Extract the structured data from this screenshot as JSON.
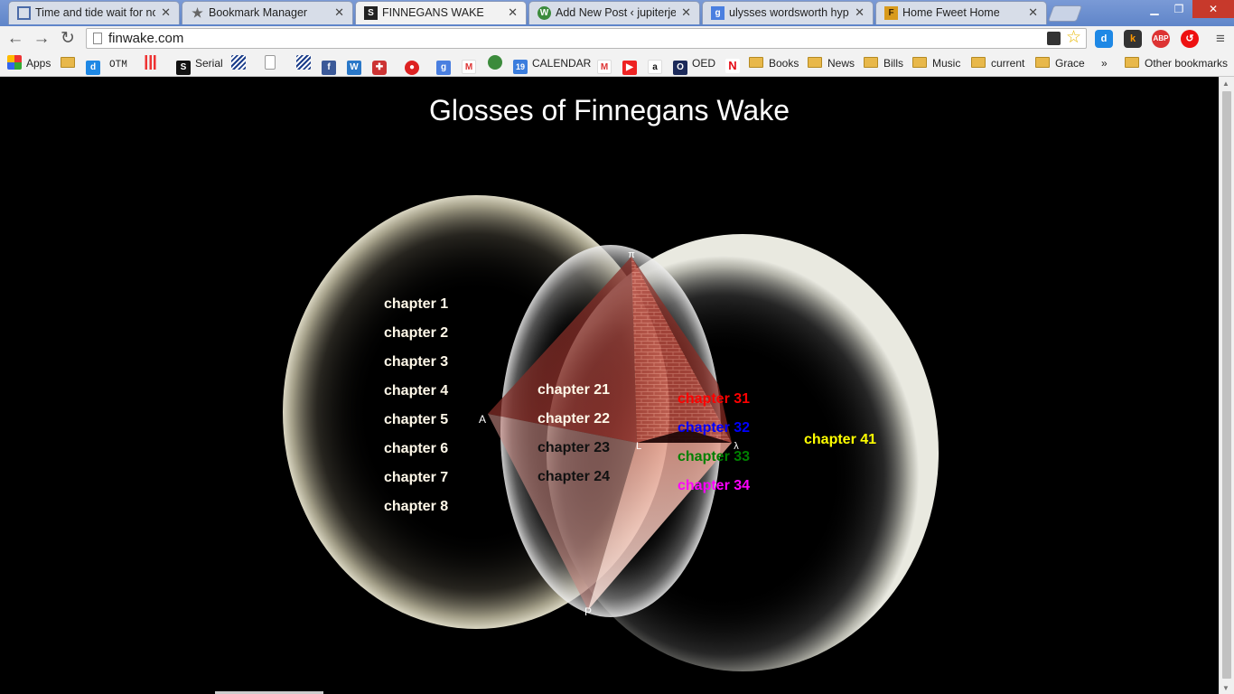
{
  "browser": {
    "tabs": [
      {
        "title": "Time and tide wait for no",
        "icon": "spiral-square-icon",
        "active": false
      },
      {
        "title": "Bookmark Manager",
        "icon": "star-icon",
        "active": false
      },
      {
        "title": "FINNEGANS WAKE",
        "icon": "s-logo-icon",
        "active": true
      },
      {
        "title": "Add New Post ‹ jupiterjen",
        "icon": "wordpress-icon",
        "active": false
      },
      {
        "title": "ulysses wordsworth hyper",
        "icon": "google-icon",
        "active": false
      },
      {
        "title": "Home Fweet Home",
        "icon": "fweet-icon",
        "active": false
      }
    ],
    "url": "finwake.com",
    "bookmarks": [
      {
        "label": "Apps",
        "icon": "apps-grid-icon"
      },
      {
        "label": "",
        "icon": "folder-icon"
      },
      {
        "label": "",
        "icon": "d-icon"
      },
      {
        "label": "OTM",
        "icon": "otm-icon"
      },
      {
        "label": "",
        "icon": "bar-chart-icon"
      },
      {
        "label": "Serial",
        "icon": "serial-icon"
      },
      {
        "label": "",
        "icon": "stripes-icon"
      },
      {
        "label": "",
        "icon": "blank-page-icon"
      },
      {
        "label": "",
        "icon": "stripes-icon-2"
      },
      {
        "label": "",
        "icon": "facebook-icon"
      },
      {
        "label": "",
        "icon": "w-icon"
      },
      {
        "label": "",
        "icon": "cross-icon"
      },
      {
        "label": "",
        "icon": "target-icon"
      },
      {
        "label": "",
        "icon": "google-icon"
      },
      {
        "label": "",
        "icon": "gmail-icon"
      },
      {
        "label": "",
        "icon": "globe-icon"
      },
      {
        "label": "CALENDAR",
        "icon": "calendar-icon"
      },
      {
        "label": "",
        "icon": "gmail-icon-2"
      },
      {
        "label": "",
        "icon": "youtube-icon"
      },
      {
        "label": "",
        "icon": "amazon-icon"
      },
      {
        "label": "OED",
        "icon": "oed-icon"
      },
      {
        "label": "",
        "icon": "netflix-icon"
      },
      {
        "label": "Books",
        "icon": "folder-icon"
      },
      {
        "label": "News",
        "icon": "folder-icon"
      },
      {
        "label": "Bills",
        "icon": "folder-icon"
      },
      {
        "label": "Music",
        "icon": "folder-icon"
      },
      {
        "label": "current",
        "icon": "folder-icon"
      },
      {
        "label": "Grace",
        "icon": "folder-icon"
      }
    ],
    "overflow_label": "»",
    "other_bookmarks": "Other bookmarks",
    "calendar_day": "19"
  },
  "page": {
    "title": "Glosses of Finnegans Wake",
    "group1": [
      "chapter 1",
      "chapter 2",
      "chapter 3",
      "chapter 4",
      "chapter 5",
      "chapter 6",
      "chapter 7",
      "chapter 8"
    ],
    "group2": [
      "chapter 21",
      "chapter 22",
      "chapter 23",
      "chapter 24"
    ],
    "group3": [
      {
        "label": "chapter 31",
        "color": "#ff0000"
      },
      {
        "label": "chapter 32",
        "color": "#0000ff"
      },
      {
        "label": "chapter 33",
        "color": "#008000"
      },
      {
        "label": "chapter 34",
        "color": "#ff00ff"
      }
    ],
    "group4": [
      {
        "label": "chapter 41",
        "color": "#ffff00"
      }
    ],
    "vertex_labels": {
      "top": "π",
      "left": "A",
      "center": "L",
      "right": "λ",
      "bottom": "P"
    }
  }
}
